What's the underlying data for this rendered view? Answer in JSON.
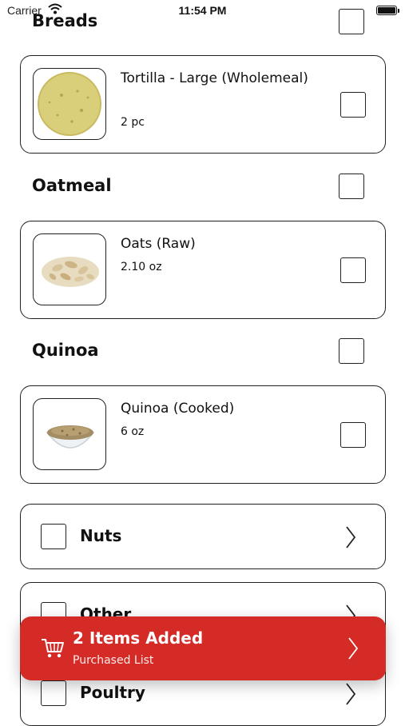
{
  "status_bar": {
    "carrier": "Carrier",
    "time": "11:54 PM"
  },
  "sections": [
    {
      "title": "Breads",
      "items": [
        {
          "name": "Tortilla - Large (Wholemeal)",
          "quantity": "2 pc"
        }
      ]
    },
    {
      "title": "Oatmeal",
      "items": [
        {
          "name": "Oats (Raw)",
          "quantity": "2.10 oz"
        }
      ]
    },
    {
      "title": "Quinoa",
      "items": [
        {
          "name": "Quinoa (Cooked)",
          "quantity": "6 oz"
        }
      ]
    }
  ],
  "categories": [
    {
      "label": "Nuts"
    },
    {
      "label": "Other"
    },
    {
      "label": "Poultry"
    }
  ],
  "toast": {
    "title": "2 Items Added",
    "subtitle": "Purchased List"
  },
  "colors": {
    "accent": "#d42b27",
    "border": "#222222",
    "background": "#ffffff"
  }
}
